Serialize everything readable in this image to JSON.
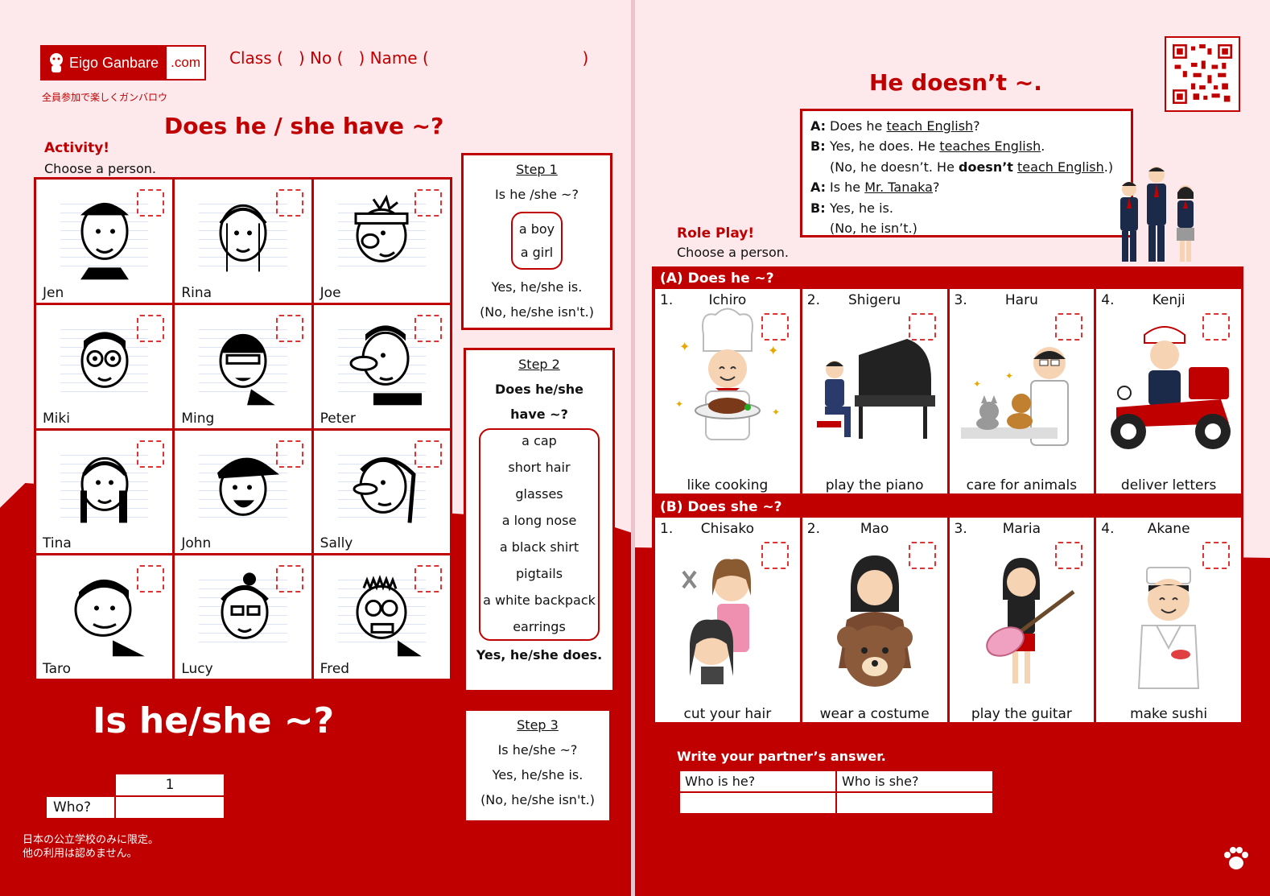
{
  "left_page": {
    "logo": {
      "main": "Eigo Ganbare",
      "dot": ".com"
    },
    "class_line": "Class (   ) No (   ) Name (                              )",
    "tagline": "全員参加で楽しくガンバロウ",
    "title": "Does he / she have ~?",
    "activity": {
      "label": "Activity!",
      "instruction": "Choose a person."
    },
    "people": [
      "Jen",
      "Rina",
      "Joe",
      "Miki",
      "Ming",
      "Peter",
      "Tina",
      "John",
      "Sally",
      "Taro",
      "Lucy",
      "Fred"
    ],
    "step1": {
      "heading": "Step 1",
      "q": "Is he /she ~?",
      "options": [
        "a boy",
        "a girl"
      ],
      "yes": "Yes, he/she is.",
      "no": "(No, he/she isn't.)"
    },
    "step2": {
      "heading": "Step 2",
      "q1": "Does he/she",
      "q2": "have ~?",
      "options": [
        "a cap",
        "short hair",
        "glasses",
        "a long nose",
        "a black shirt",
        "pigtails",
        "a white backpack",
        "earrings"
      ],
      "yes": "Yes, he/she does."
    },
    "step3": {
      "heading": "Step 3",
      "q": "Is he/she ~?",
      "yes": "Yes, he/she is.",
      "no": "(No, he/she isn't.)"
    },
    "big_question": "Is he/she ~?",
    "table": {
      "col1": "1",
      "row_label": "Who?"
    },
    "footer_jp_1": "日本の公立学校のみに限定。",
    "footer_jp_2": "他の利用は認めません。"
  },
  "right_page": {
    "title": "He doesn’t ~.",
    "dialog": {
      "a1_label": "A:",
      "a1_pre": "Does he ",
      "a1_u": "teach English",
      "a1_post": "?",
      "b1_label": "B:",
      "b1_pre": "Yes, he does. He ",
      "b1_u": "teaches English",
      "b1_post": ".",
      "b1n_pre": "(No, he doesn’t. He ",
      "b1n_b": "doesn’t",
      "b1n_sp": " ",
      "b1n_u": "teach English",
      "b1n_post": ".)",
      "a2_label": "A:",
      "a2_pre": "Is he ",
      "a2_u": "Mr. Tanaka",
      "a2_post": "?",
      "b2_label": "B:",
      "b2_text": "Yes, he is.",
      "b2n": "(No, he isn’t.)"
    },
    "role_play": {
      "label": "Role Play!",
      "instruction": "Choose a person."
    },
    "section_a": {
      "heading": "(A) Does he ~?",
      "items": [
        {
          "num": "1.",
          "name": "Ichiro",
          "action": "like cooking"
        },
        {
          "num": "2.",
          "name": "Shigeru",
          "action": "play the piano"
        },
        {
          "num": "3.",
          "name": "Haru",
          "action": "care for animals"
        },
        {
          "num": "4.",
          "name": "Kenji",
          "action": "deliver letters"
        }
      ]
    },
    "section_b": {
      "heading": "(B) Does she ~?",
      "items": [
        {
          "num": "1.",
          "name": "Chisako",
          "action": "cut your hair"
        },
        {
          "num": "2.",
          "name": "Mao",
          "action": "wear a costume"
        },
        {
          "num": "3.",
          "name": "Maria",
          "action": "play the guitar"
        },
        {
          "num": "4.",
          "name": "Akane",
          "action": "make sushi"
        }
      ]
    },
    "write_label": "Write your partner’s answer.",
    "answer_table": {
      "he": "Who is he?",
      "she": "Who is she?"
    }
  },
  "colors": {
    "accent": "#c00000",
    "background": "#fde8ec"
  }
}
